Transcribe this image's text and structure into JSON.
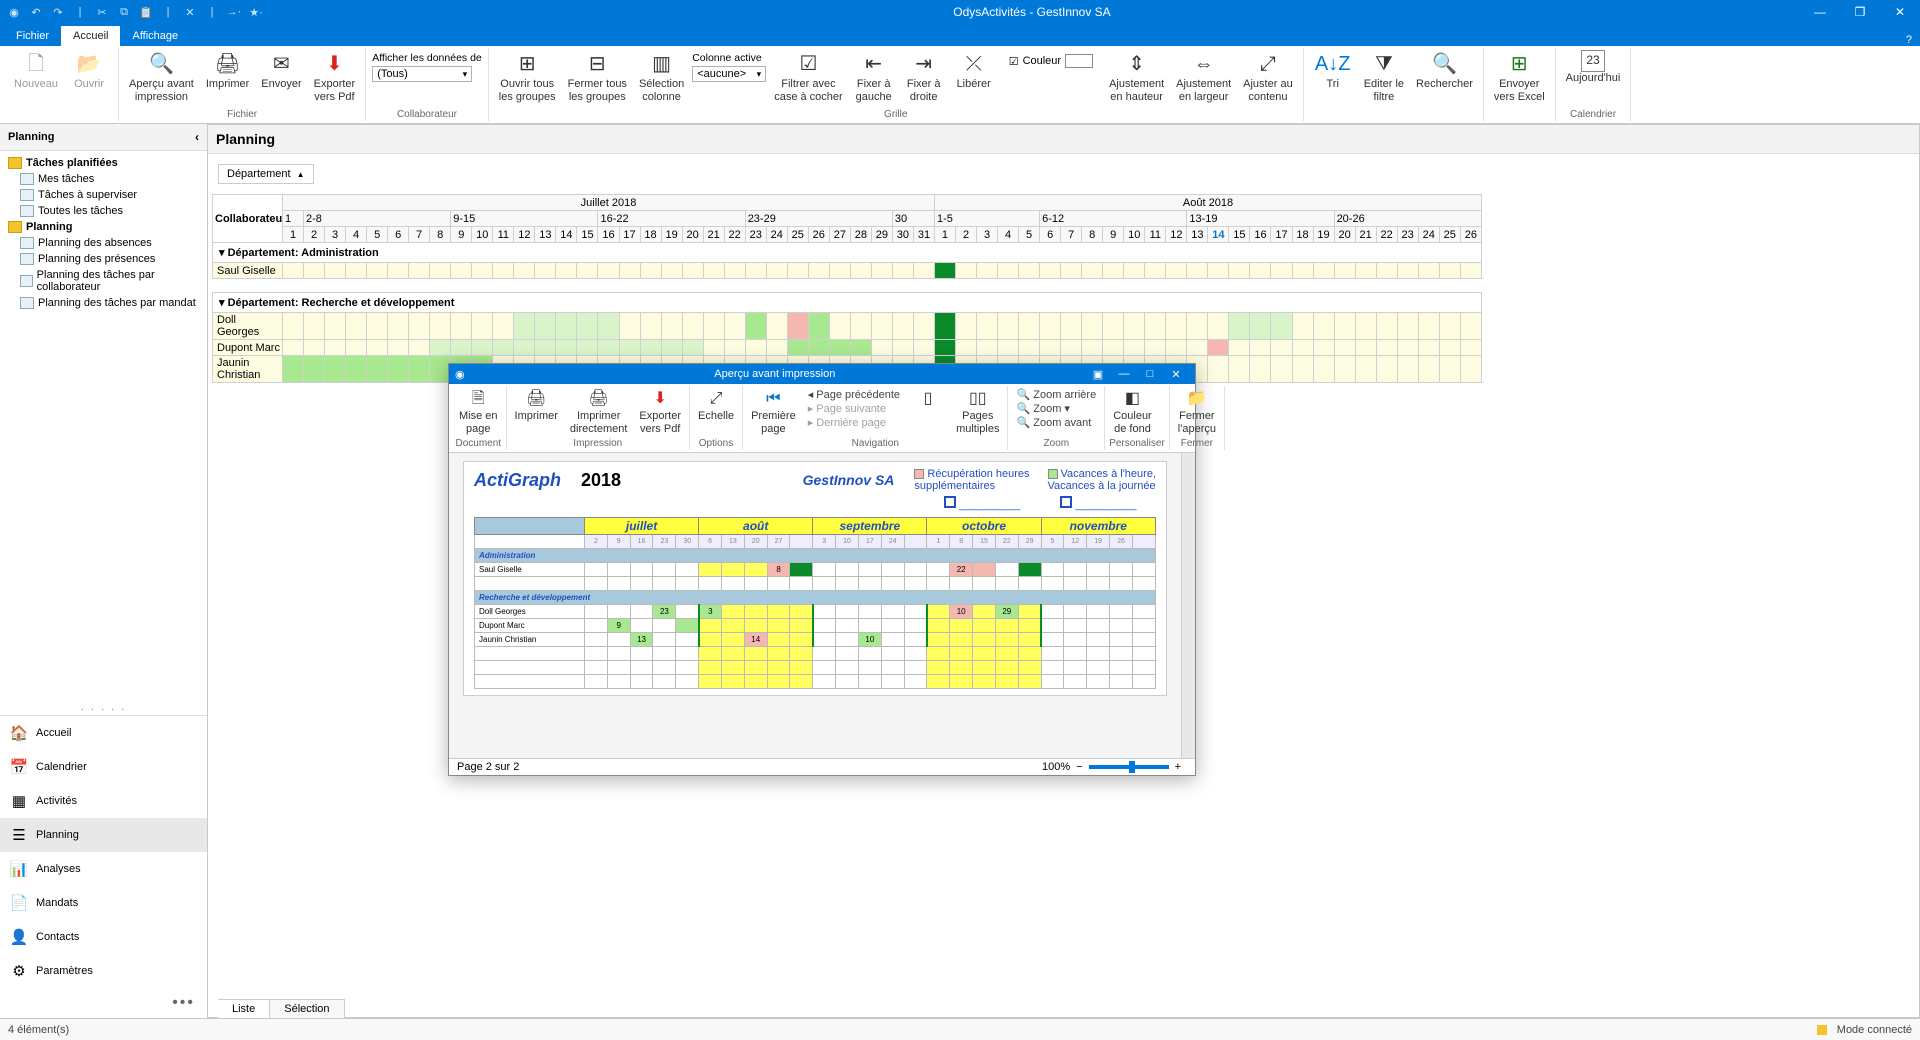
{
  "app": {
    "title": "OdysActivités - GestInnov SA"
  },
  "menu": {
    "fichier": "Fichier",
    "accueil": "Accueil",
    "affichage": "Affichage"
  },
  "ribbon": {
    "nouveau": "Nouveau",
    "ouvrir": "Ouvrir",
    "apercu": "Aperçu avant\nimpression",
    "imprimer": "Imprimer",
    "envoyer": "Envoyer",
    "exporter_pdf": "Exporter\nvers Pdf",
    "g_fichier": "Fichier",
    "afficher_label": "Afficher les données de",
    "tous": "(Tous)",
    "g_collab": "Collaborateur",
    "ouvrir_groupes": "Ouvrir tous\nles groupes",
    "fermer_groupes": "Fermer tous\nles groupes",
    "sel_colonne": "Sélection\ncolonne",
    "col_active_label": "Colonne active",
    "aucune": "<aucune>",
    "filtrer_cocher": "Filtrer avec\ncase à cocher",
    "fixer_gauche": "Fixer à\ngauche",
    "fixer_droite": "Fixer à\ndroite",
    "liberer": "Libérer",
    "couleur": "Couleur",
    "aj_hauteur": "Ajustement\nen hauteur",
    "aj_largeur": "Ajustement\nen largeur",
    "aj_contenu": "Ajuster au\ncontenu",
    "g_grille": "Grille",
    "tri": "Tri",
    "editer_filtre": "Editer le\nfiltre",
    "rechercher": "Rechercher",
    "envoyer_excel": "Envoyer\nvers Excel",
    "aujourdhui": "Aujourd'hui",
    "g_cal": "Calendrier",
    "cal_day": "23"
  },
  "sidebar": {
    "title": "Planning",
    "folder_tp": "Tâches planifiées",
    "tp": [
      "Mes tâches",
      "Tâches à superviser",
      "Toutes les tâches"
    ],
    "folder_pl": "Planning",
    "pl": [
      "Planning des absences",
      "Planning des présences",
      "Planning des tâches par collaborateur",
      "Planning des tâches par mandat"
    ]
  },
  "nav": [
    "Accueil",
    "Calendrier",
    "Activités",
    "Planning",
    "Analyses",
    "Mandats",
    "Contacts",
    "Paramètres"
  ],
  "main": {
    "title": "Planning",
    "groupby": "Département",
    "months": [
      "Juillet 2018",
      "Août 2018"
    ],
    "weeks_jul": [
      "1",
      "2-8",
      "9-15",
      "16-22",
      "23-29",
      "30"
    ],
    "weeks_aug": [
      "1-5",
      "6-12",
      "13-19",
      "20-26"
    ],
    "days": [
      "1",
      "2",
      "3",
      "4",
      "5",
      "6",
      "7",
      "8",
      "9",
      "10",
      "11",
      "12",
      "13",
      "14",
      "15",
      "16",
      "17",
      "18",
      "19",
      "20",
      "21",
      "22",
      "23",
      "24",
      "25",
      "26",
      "27",
      "28",
      "29",
      "30",
      "31",
      "1",
      "2",
      "3",
      "4",
      "5",
      "6",
      "7",
      "8",
      "9",
      "10",
      "11",
      "12",
      "13",
      "14",
      "15",
      "16",
      "17",
      "18",
      "19",
      "20",
      "21",
      "22",
      "23",
      "24",
      "25",
      "26"
    ],
    "current_day_idx": 44,
    "collab_label": "Collaborateurs",
    "dept1": "Département: Administration",
    "dept1_rows": [
      "Saul Giselle"
    ],
    "dept2": "Département: Recherche et développement",
    "dept2_rows": [
      "Doll Georges",
      "Dupont Marc",
      "Jaunin Christian"
    ]
  },
  "btabs": {
    "liste": "Liste",
    "selection": "Sélection"
  },
  "preview": {
    "title": "Aperçu avant impression",
    "mise_page": "Mise en\npage",
    "imprimer": "Imprimer",
    "imprimer_dir": "Imprimer\ndirectement",
    "export_pdf": "Exporter\nvers Pdf",
    "echelle": "Echelle",
    "premiere": "Première\npage",
    "page_prec": "Page précédente",
    "page_suiv": "Page suivante",
    "dern_page": "Dernière page",
    "pages_multi": "Pages\nmultiples",
    "zoom_arr": "Zoom arrière",
    "zoom": "Zoom",
    "zoom_av": "Zoom avant",
    "couleur_fond": "Couleur\nde fond",
    "fermer": "Fermer\nl'aperçu",
    "g_doc": "Document",
    "g_imp": "Impression",
    "g_opt": "Options",
    "g_nav": "Navigation",
    "g_zoom": "Zoom",
    "g_pers": "Personaliser",
    "g_ferm": "Fermer",
    "brand": "ActiGraph",
    "year": "2018",
    "company": "GestInnov SA",
    "legend1": "Récupération heures\nsupplémentaires",
    "legend2": "Vacances à l'heure,\nVacances à la journée",
    "months": [
      "juillet",
      "août",
      "septembre",
      "octobre",
      "novembre"
    ],
    "grp1": "Administration",
    "grp1_rows": [
      "Saul Giselle"
    ],
    "grp2": "Recherche et développement",
    "grp2_rows": [
      "Doll Georges",
      "Dupont Marc",
      "Jaunin Christian"
    ],
    "footer": "Page 2 sur 2",
    "zoom_pct": "100%"
  },
  "status": {
    "left": "4 élément(s)",
    "mode": "Mode connecté"
  }
}
